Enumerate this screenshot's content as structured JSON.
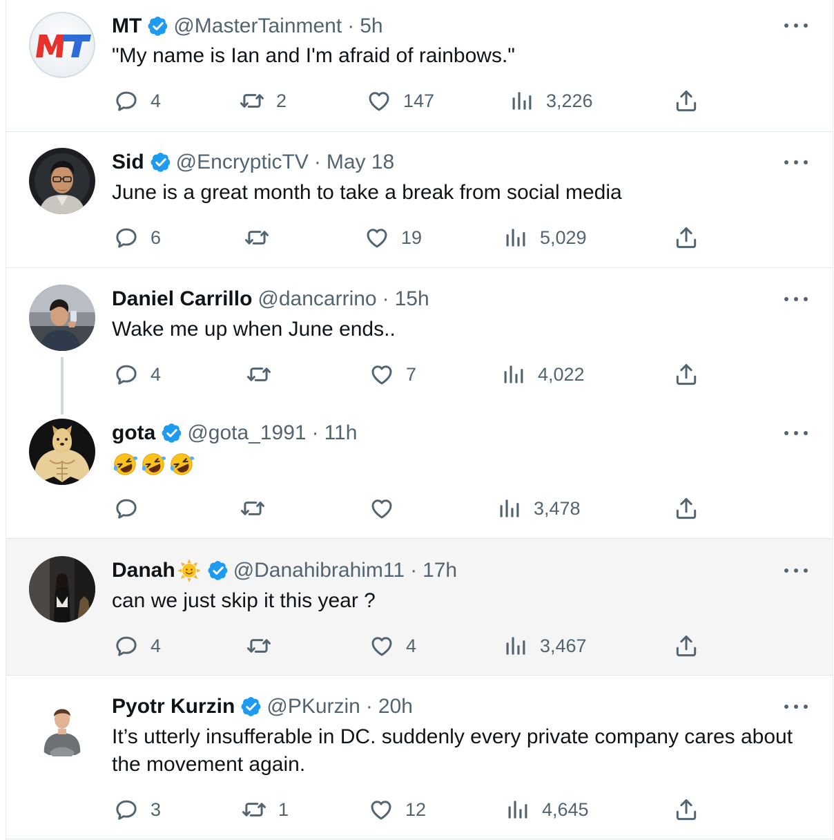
{
  "colors": {
    "verified": "#1d9bf0",
    "text": "#0f1419",
    "muted": "#536471",
    "highlight_bg": "#f5f5f5"
  },
  "tweets": [
    {
      "name": "MT",
      "verified": true,
      "handle": "@MasterTainment",
      "separator": "·",
      "time": "5h",
      "text": "\"My name is Ian and I'm afraid of rainbows.\"",
      "replies": "4",
      "retweets": "2",
      "likes": "147",
      "views": "3,226",
      "avatar": "mt-logo-avatar"
    },
    {
      "name": "Sid",
      "verified": true,
      "handle": "@EncrypticTV",
      "separator": "·",
      "time": "May 18",
      "text": "June is a great month to take a break from social media",
      "replies": "6",
      "retweets": "",
      "likes": "19",
      "views": "5,029",
      "avatar": "man-with-glasses-avatar"
    },
    {
      "name": "Daniel Carrillo",
      "verified": false,
      "handle": "@dancarrino",
      "separator": "·",
      "time": "15h",
      "text": "Wake me up when June ends..",
      "replies": "4",
      "retweets": "",
      "likes": "7",
      "views": "4,022",
      "avatar": "man-with-phone-avatar"
    },
    {
      "name": "gota",
      "verified": true,
      "handle": "@gota_1991",
      "separator": "·",
      "time": "11h",
      "text": "🤣🤣🤣",
      "replies": "",
      "retweets": "",
      "likes": "",
      "views": "3,478",
      "avatar": "buff-doge-avatar"
    },
    {
      "name": "Danah",
      "name_emoji": "sun-face-emoji",
      "verified": true,
      "handle": "@Danahibrahim11",
      "separator": "·",
      "time": "17h",
      "text": "can we just skip it this year ?",
      "replies": "4",
      "retweets": "",
      "likes": "4",
      "views": "3,467",
      "avatar": "woman-standing-avatar"
    },
    {
      "name": "Pyotr Kurzin",
      "verified": true,
      "handle": "@PKurzin",
      "separator": "·",
      "time": "20h",
      "text": "It’s utterly insufferable in DC. suddenly every private company cares about the movement again.",
      "replies": "3",
      "retweets": "1",
      "likes": "12",
      "views": "4,645",
      "avatar": "man-sitting-avatar"
    }
  ]
}
